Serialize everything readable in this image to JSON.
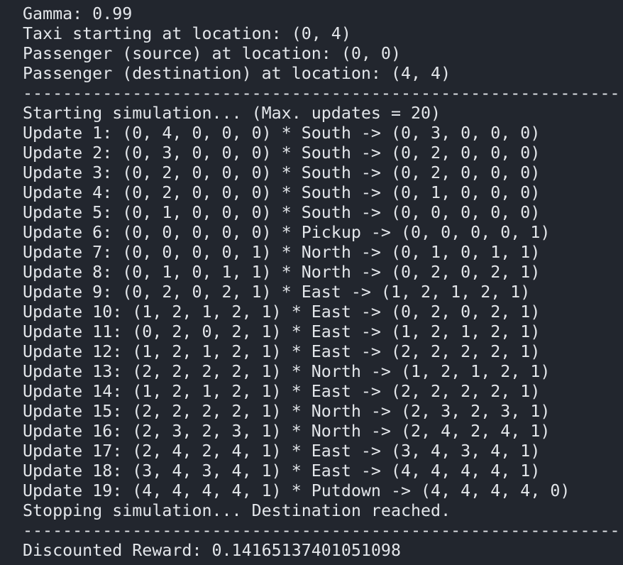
{
  "terminal": {
    "lines": [
      "Gamma: 0.99",
      "Taxi starting at location: (0, 4)",
      "Passenger (source) at location: (0, 0)",
      "Passenger (destination) at location: (4, 4)",
      "------------------------------------------------------------",
      "Starting simulation... (Max. updates = 20)",
      "Update 1: (0, 4, 0, 0, 0) * South -> (0, 3, 0, 0, 0)",
      "Update 2: (0, 3, 0, 0, 0) * South -> (0, 2, 0, 0, 0)",
      "Update 3: (0, 2, 0, 0, 0) * South -> (0, 2, 0, 0, 0)",
      "Update 4: (0, 2, 0, 0, 0) * South -> (0, 1, 0, 0, 0)",
      "Update 5: (0, 1, 0, 0, 0) * South -> (0, 0, 0, 0, 0)",
      "Update 6: (0, 0, 0, 0, 0) * Pickup -> (0, 0, 0, 0, 1)",
      "Update 7: (0, 0, 0, 0, 1) * North -> (0, 1, 0, 1, 1)",
      "Update 8: (0, 1, 0, 1, 1) * North -> (0, 2, 0, 2, 1)",
      "Update 9: (0, 2, 0, 2, 1) * East -> (1, 2, 1, 2, 1)",
      "Update 10: (1, 2, 1, 2, 1) * East -> (0, 2, 0, 2, 1)",
      "Update 11: (0, 2, 0, 2, 1) * East -> (1, 2, 1, 2, 1)",
      "Update 12: (1, 2, 1, 2, 1) * East -> (2, 2, 2, 2, 1)",
      "Update 13: (2, 2, 2, 2, 1) * North -> (1, 2, 1, 2, 1)",
      "Update 14: (1, 2, 1, 2, 1) * East -> (2, 2, 2, 2, 1)",
      "Update 15: (2, 2, 2, 2, 1) * North -> (2, 3, 2, 3, 1)",
      "Update 16: (2, 3, 2, 3, 1) * North -> (2, 4, 2, 4, 1)",
      "Update 17: (2, 4, 2, 4, 1) * East -> (3, 4, 3, 4, 1)",
      "Update 18: (3, 4, 3, 4, 1) * East -> (4, 4, 4, 4, 1)",
      "Update 19: (4, 4, 4, 4, 1) * Putdown -> (4, 4, 4, 4, 0)",
      "Stopping simulation... Destination reached.",
      "------------------------------------------------------------",
      "Discounted Reward: 0.14165137401051098"
    ]
  },
  "colors": {
    "background": "#22262e",
    "foreground": "#e3e6ea"
  }
}
